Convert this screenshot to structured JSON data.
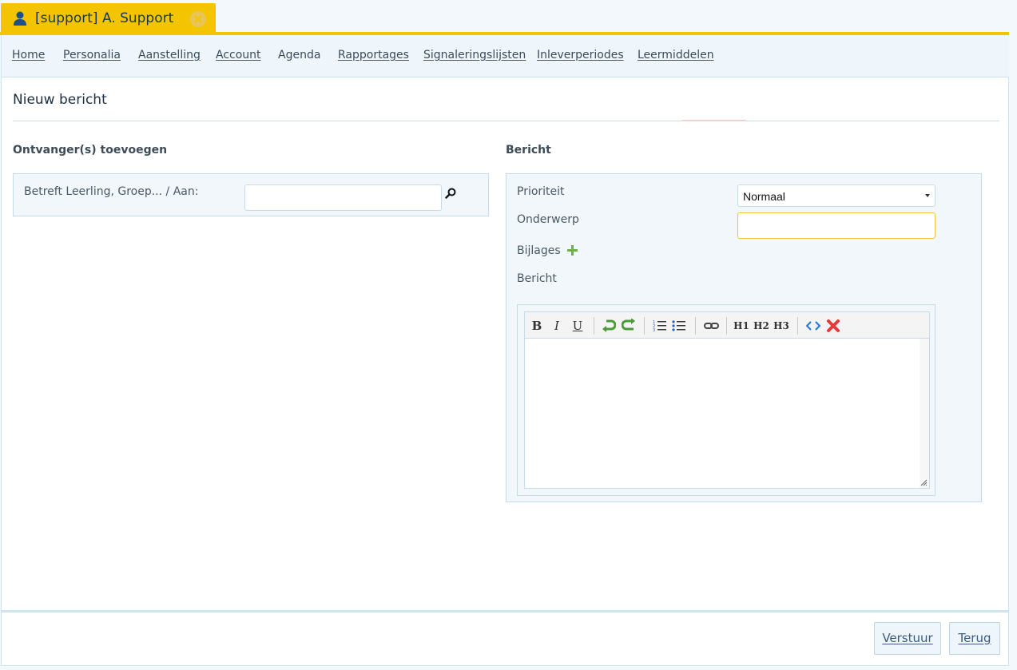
{
  "tab": {
    "label": "[support]  A. Support"
  },
  "nav": {
    "items": [
      {
        "label": "Home"
      },
      {
        "label": "Personalia"
      },
      {
        "label": "Aanstelling"
      },
      {
        "label": "Account"
      },
      {
        "label": "Agenda"
      },
      {
        "label": "Rapportages"
      },
      {
        "label": "Signaleringslijsten"
      },
      {
        "label": "Inleverperiodes"
      },
      {
        "label": "Leermiddelen"
      }
    ]
  },
  "page": {
    "title": "Nieuw bericht"
  },
  "recipients": {
    "heading": "Ontvanger(s) toevoegen",
    "label": "Betreft Leerling, Groep... / Aan:",
    "value": ""
  },
  "message": {
    "heading": "Bericht",
    "priority_label": "Prioriteit",
    "priority_value": "Normaal",
    "subject_label": "Onderwerp",
    "subject_value": "",
    "attachments_label": "Bijlages",
    "body_label": "Bericht"
  },
  "editor": {
    "toolbar": [
      {
        "name": "bold",
        "label": "B"
      },
      {
        "name": "italic",
        "label": "I"
      },
      {
        "name": "underline",
        "label": "U"
      },
      {
        "name": "h1",
        "label": "H1"
      },
      {
        "name": "h2",
        "label": "H2"
      },
      {
        "name": "h3",
        "label": "H3"
      }
    ]
  },
  "footer": {
    "send_label": "Verstuur",
    "back_label": "Terug"
  },
  "colors": {
    "tab": "#f5c400",
    "accent_green": "#6cb33f",
    "remove_red": "#e63a3a",
    "link_blue": "#3d5a80"
  }
}
